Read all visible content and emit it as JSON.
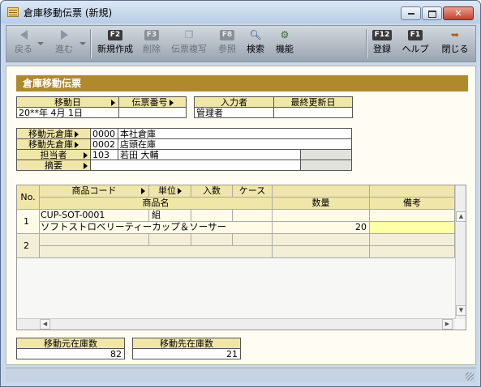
{
  "window": {
    "title": "倉庫移動伝票 (新規)",
    "controls": {
      "minimize": "",
      "maximize": "",
      "close": "✕"
    }
  },
  "toolbar": {
    "back": {
      "label": "戻る"
    },
    "forward": {
      "label": "進む"
    },
    "new": {
      "key": "F2",
      "label": "新規作成"
    },
    "delete": {
      "key": "F3",
      "label": "削除"
    },
    "copy": {
      "label": "伝票複写"
    },
    "reference": {
      "key": "F8",
      "label": "参照"
    },
    "search": {
      "label": "検索"
    },
    "function": {
      "label": "機能"
    },
    "register": {
      "key": "F12",
      "label": "登録"
    },
    "help": {
      "key": "F1",
      "label": "ヘルプ"
    },
    "close": {
      "label": "閉じる"
    }
  },
  "form": {
    "section_title": "倉庫移動伝票",
    "move_date_label": "移動日",
    "move_date_value": "20**年 4月 1日",
    "voucher_no_label": "伝票番号",
    "voucher_no_value": "",
    "entered_by_label": "入力者",
    "entered_by_value": "管理者",
    "last_updated_label": "最終更新日",
    "last_updated_value": "",
    "source_wh_label": "移動元倉庫",
    "source_wh_code": "0000",
    "source_wh_name": "本社倉庫",
    "dest_wh_label": "移動先倉庫",
    "dest_wh_code": "0002",
    "dest_wh_name": "店頭在庫",
    "staff_label": "担当者",
    "staff_code": "103",
    "staff_name": "若田 大輔",
    "memo_label": "摘要",
    "memo_value": ""
  },
  "grid": {
    "headers": {
      "no": "No.",
      "product_code": "商品コード",
      "unit": "単位",
      "qty_per": "入数",
      "case": "ケース",
      "product_name": "商品名",
      "quantity": "数量",
      "remarks": "備考"
    },
    "rows": [
      {
        "no": "1",
        "product_code": "CUP-SOT-0001",
        "unit": "組",
        "product_name": "ソフトストロベリーティーカップ＆ソーサー",
        "quantity": "20",
        "remarks": ""
      },
      {
        "no": "2",
        "product_code": "",
        "unit": "",
        "product_name": "",
        "quantity": "",
        "remarks": ""
      }
    ]
  },
  "footer": {
    "source_stock_label": "移動元在庫数",
    "source_stock_value": "82",
    "dest_stock_label": "移動先在庫数",
    "dest_stock_value": "21"
  },
  "colors": {
    "section_title_bg": "#b0892d",
    "header_bg": "#f0e6a8",
    "selected_cell": "#ffffa8"
  }
}
